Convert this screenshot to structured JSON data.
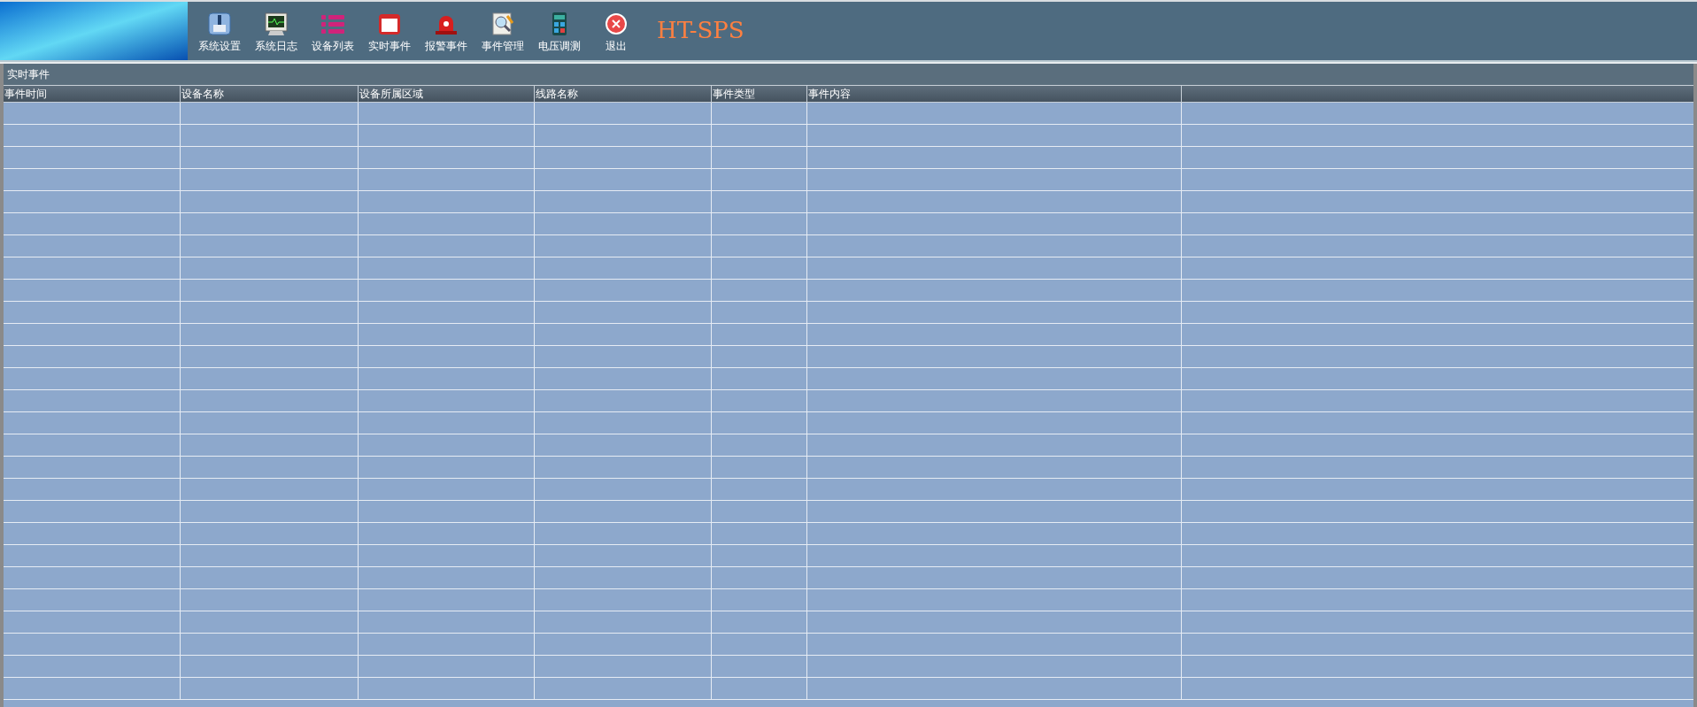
{
  "toolbar": {
    "buttons": [
      {
        "kind": "settings",
        "label": "系统设置"
      },
      {
        "kind": "log",
        "label": "系统日志"
      },
      {
        "kind": "list",
        "label": "设备列表"
      },
      {
        "kind": "realtime",
        "label": "实时事件"
      },
      {
        "kind": "alarm",
        "label": "报警事件"
      },
      {
        "kind": "manage",
        "label": "事件管理"
      },
      {
        "kind": "voltage",
        "label": "电压调测"
      },
      {
        "kind": "exit",
        "label": "退出"
      }
    ],
    "brand": "HT-SPS"
  },
  "panel": {
    "title": "实时事件"
  },
  "table": {
    "columns": [
      "事件时间",
      "设备名称",
      "设备所属区域",
      "线路名称",
      "事件类型",
      "事件内容"
    ]
  }
}
